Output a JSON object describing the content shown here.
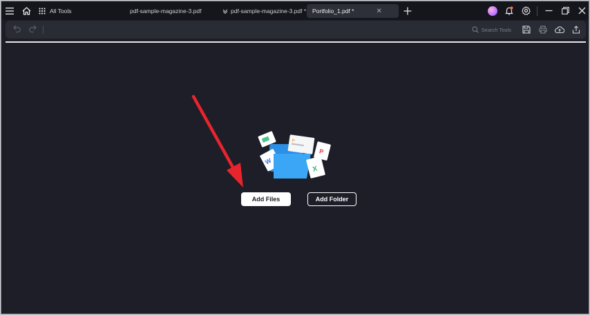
{
  "titlebar": {
    "all_tools_label": "All Tools",
    "tabs": [
      {
        "label": "pdf-sample-magazine-3.pdf"
      },
      {
        "label": "pdf-sample-magazine-3.pdf *"
      },
      {
        "label": "Portfolio_1.pdf *",
        "close": "✕"
      }
    ],
    "icons": {
      "menu": "menu-icon",
      "home": "home-icon",
      "grid": "grid-icon",
      "add_tab": "plus-icon",
      "notifications": "bell-icon",
      "settings": "gear-icon",
      "minimize": "minimize-icon",
      "restore": "restore-icon",
      "close": "close-icon"
    }
  },
  "toolbar": {
    "search_placeholder": "Search Tools",
    "icons": [
      "undo-icon",
      "redo-icon",
      "search-icon",
      "save-icon",
      "print-icon",
      "cloud-upload-icon",
      "share-icon"
    ]
  },
  "main": {
    "add_files_label": "Add Files",
    "add_folder_label": "Add Folder",
    "illustration_letters": {
      "word": "W",
      "powerpoint": "P",
      "excel": "X",
      "pdf": "P"
    }
  },
  "colors": {
    "background": "#1d1e28",
    "titlebar": "#15161c",
    "toolbar": "#2a2c35",
    "arrow": "#e8242c",
    "folder": "#3aa6f5"
  }
}
